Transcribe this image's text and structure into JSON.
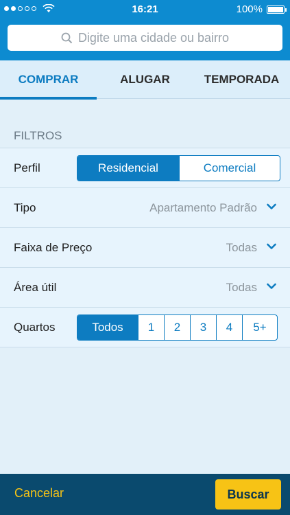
{
  "status_bar": {
    "time": "16:21",
    "battery": "100%"
  },
  "search": {
    "placeholder": "Digite uma cidade ou bairro"
  },
  "tabs": [
    {
      "label": "COMPRAR",
      "active": true
    },
    {
      "label": "ALUGAR",
      "active": false
    },
    {
      "label": "TEMPORADA",
      "active": false
    }
  ],
  "filters": {
    "section_title": "FILTROS",
    "perfil": {
      "label": "Perfil",
      "options": [
        "Residencial",
        "Comercial"
      ],
      "selected": "Residencial"
    },
    "tipo": {
      "label": "Tipo",
      "value": "Apartamento Padrão"
    },
    "preco": {
      "label": "Faixa de Preço",
      "value": "Todas"
    },
    "area": {
      "label": "Área útil",
      "value": "Todas"
    },
    "quartos": {
      "label": "Quartos",
      "options": [
        "Todos",
        "1",
        "2",
        "3",
        "4",
        "5+"
      ],
      "selected": "Todos"
    }
  },
  "footer": {
    "cancel_label": "Cancelar",
    "search_label": "Buscar"
  },
  "colors": {
    "primary": "#0d7cc1",
    "header": "#0d8bd0",
    "footer": "#0a4a6e",
    "accent": "#f7c315"
  }
}
